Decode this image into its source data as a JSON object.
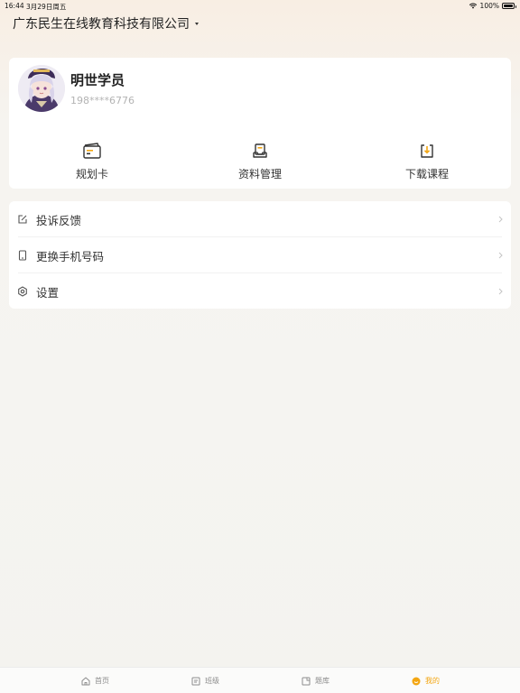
{
  "status_bar": {
    "time": "16:44",
    "date": "3月29日周五",
    "battery": "100%"
  },
  "header": {
    "org_name": "广东民生在线教育科技有限公司"
  },
  "profile": {
    "name": "明世学员",
    "phone": "198****6776"
  },
  "quick_actions": [
    {
      "label": "规划卡",
      "icon": "card-icon"
    },
    {
      "label": "资料管理",
      "icon": "materials-icon"
    },
    {
      "label": "下载课程",
      "icon": "download-icon"
    }
  ],
  "menu": [
    {
      "label": "投诉反馈",
      "icon": "edit-icon"
    },
    {
      "label": "更换手机号码",
      "icon": "phone-icon"
    },
    {
      "label": "设置",
      "icon": "settings-icon"
    }
  ],
  "tabs": [
    {
      "label": "首页",
      "icon": "home-icon"
    },
    {
      "label": "班级",
      "icon": "class-icon"
    },
    {
      "label": "题库",
      "icon": "question-bank-icon"
    },
    {
      "label": "我的",
      "icon": "profile-icon",
      "active": true
    }
  ],
  "colors": {
    "accent": "#f3a612",
    "card_bg": "#ffffff",
    "page_bg": "#f5f4f1"
  }
}
